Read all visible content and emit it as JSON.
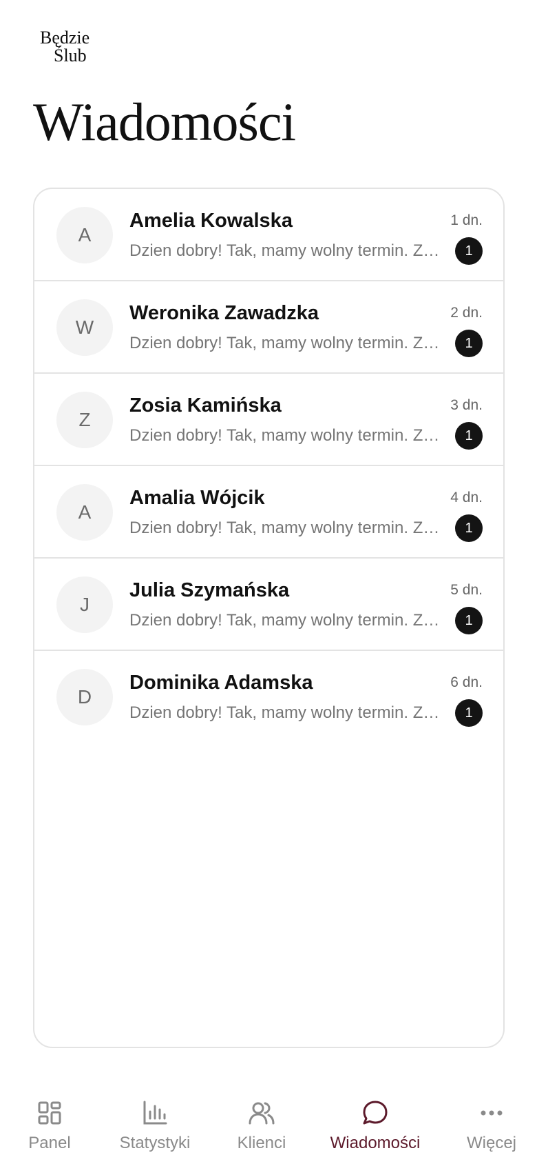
{
  "brand": {
    "line1": "Będzie",
    "line2": "Ślub"
  },
  "page": {
    "title": "Wiadomości"
  },
  "conversations": [
    {
      "initial": "A",
      "name": "Amelia Kowalska",
      "preview": "Dzien dobry! Tak, mamy wolny termin. Zapraszam na spotkanie.",
      "time": "1 dn.",
      "unread": "1"
    },
    {
      "initial": "W",
      "name": "Weronika Zawadzka",
      "preview": "Dzien dobry! Tak, mamy wolny termin. Zapraszam na spotkanie.",
      "time": "2 dn.",
      "unread": "1"
    },
    {
      "initial": "Z",
      "name": "Zosia Kamińska",
      "preview": "Dzien dobry! Tak, mamy wolny termin. Zapraszam na spotkanie.",
      "time": "3 dn.",
      "unread": "1"
    },
    {
      "initial": "A",
      "name": "Amalia Wójcik",
      "preview": "Dzien dobry! Tak, mamy wolny termin. Zapraszam na spotkanie.",
      "time": "4 dn.",
      "unread": "1"
    },
    {
      "initial": "J",
      "name": "Julia Szymańska",
      "preview": "Dzien dobry! Tak, mamy wolny termin. Zapraszam na spotkanie.",
      "time": "5 dn.",
      "unread": "1"
    },
    {
      "initial": "D",
      "name": "Dominika Adamska",
      "preview": "Dzien dobry! Tak, mamy wolny termin. Zapraszam na spotkanie.",
      "time": "6 dn.",
      "unread": "1"
    }
  ],
  "nav": [
    {
      "label": "Panel",
      "icon": "grid-icon",
      "active": false
    },
    {
      "label": "Statystyki",
      "icon": "bar-chart-icon",
      "active": false
    },
    {
      "label": "Klienci",
      "icon": "users-icon",
      "active": false
    },
    {
      "label": "Wiadomości",
      "icon": "chat-bubble-icon",
      "active": true
    },
    {
      "label": "Więcej",
      "icon": "more-dots-icon",
      "active": false
    }
  ],
  "colors": {
    "accent": "#5c1a2b",
    "badge": "#141414",
    "avatar_bg": "#f3f3f3",
    "border": "#e3e3e3"
  }
}
